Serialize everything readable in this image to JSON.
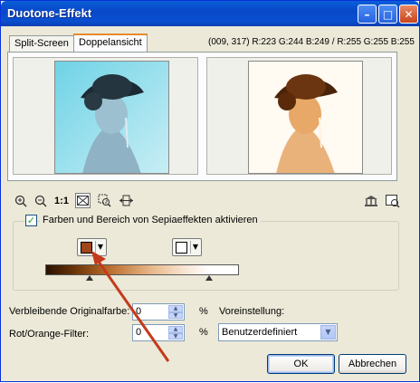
{
  "window": {
    "title": "Duotone-Effekt",
    "minimize_glyph": "–",
    "maximize_glyph": "□",
    "close_glyph": "✕"
  },
  "tabs": [
    {
      "label": "Split-Screen",
      "active": false
    },
    {
      "label": "Doppelansicht",
      "active": true
    }
  ],
  "pixel_info": "(009, 317) R:223 G:244 B:249 / R:255 G:255 B:255",
  "previews": {
    "left": "photo-cool-blue",
    "right": "photo-duotone-sepia"
  },
  "toolbar": {
    "zoom_in_icon": "zoom-in-icon",
    "zoom_out_icon": "zoom-out-icon",
    "actual_size_label": "1:1",
    "fit_icon": "fit-window-icon",
    "zoom_select_icon": "zoom-select-icon",
    "pan_icon": "pan-icon",
    "right_icons": [
      "bank-icon",
      "preview-window-icon"
    ]
  },
  "sepia": {
    "enable_label": "Farben und Bereich von Sepiaeffekten aktivieren",
    "checked": true,
    "color1": "#a0461a",
    "color2": "#ffffff"
  },
  "fields": {
    "remaining_label": "Verbleibende Originalfarbe:",
    "remaining_value": "0",
    "filter_label": "Rot/Orange-Filter:",
    "filter_value": "0",
    "percent": "%"
  },
  "preset": {
    "label": "Voreinstellung:",
    "value": "Benutzerdefiniert"
  },
  "buttons": {
    "ok": "OK",
    "cancel": "Abbrechen"
  },
  "colors": {
    "accent": "#0a5fd8",
    "arrow": "#c43a1c"
  }
}
